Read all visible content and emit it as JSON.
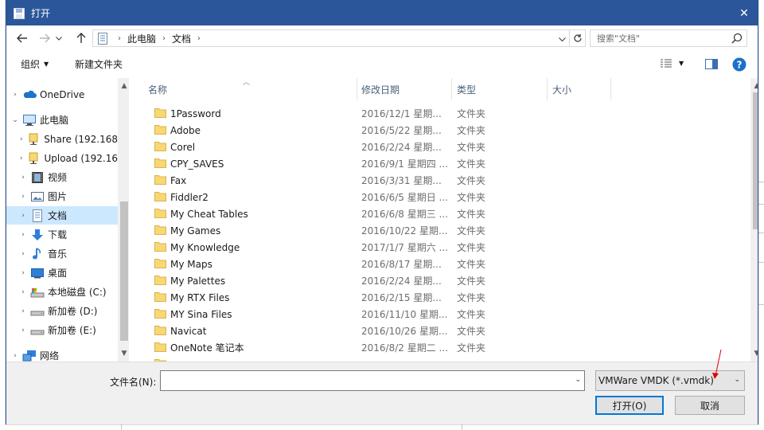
{
  "window": {
    "title": "打开",
    "close_glyph": "✕"
  },
  "address": {
    "crumbs": [
      "此电脑",
      "文档"
    ],
    "search_placeholder": "搜索\"文档\""
  },
  "toolbar": {
    "organize_label": "组织",
    "new_folder_label": "新建文件夹"
  },
  "nav": {
    "items": [
      {
        "label": "OneDrive",
        "icon": "onedrive-icon"
      },
      {
        "label": "此电脑",
        "icon": "computer-icon"
      },
      {
        "label": "Share (192.168",
        "icon": "network-drive-icon"
      },
      {
        "label": "Upload (192.16",
        "icon": "network-drive-icon"
      },
      {
        "label": "视频",
        "icon": "video-icon"
      },
      {
        "label": "图片",
        "icon": "pictures-icon"
      },
      {
        "label": "文档",
        "icon": "documents-icon"
      },
      {
        "label": "下载",
        "icon": "download-icon"
      },
      {
        "label": "音乐",
        "icon": "music-icon"
      },
      {
        "label": "桌面",
        "icon": "desktop-icon"
      },
      {
        "label": "本地磁盘 (C:)",
        "icon": "local-disk-icon"
      },
      {
        "label": "新加卷 (D:)",
        "icon": "drive-icon"
      },
      {
        "label": "新加卷 (E:)",
        "icon": "drive-icon"
      },
      {
        "label": "网络",
        "icon": "network-icon"
      }
    ]
  },
  "columns": {
    "name": "名称",
    "date": "修改日期",
    "type": "类型",
    "size": "大小"
  },
  "files": [
    {
      "name": "1Password",
      "date": "2016/12/1 星期...",
      "type": "文件夹"
    },
    {
      "name": "Adobe",
      "date": "2016/5/22 星期...",
      "type": "文件夹"
    },
    {
      "name": "Corel",
      "date": "2016/2/24 星期...",
      "type": "文件夹"
    },
    {
      "name": "CPY_SAVES",
      "date": "2016/9/1 星期四 ...",
      "type": "文件夹"
    },
    {
      "name": "Fax",
      "date": "2016/3/31 星期...",
      "type": "文件夹"
    },
    {
      "name": "Fiddler2",
      "date": "2016/6/5 星期日 ...",
      "type": "文件夹"
    },
    {
      "name": "My Cheat Tables",
      "date": "2016/6/8 星期三 ...",
      "type": "文件夹"
    },
    {
      "name": "My Games",
      "date": "2016/10/22 星期...",
      "type": "文件夹"
    },
    {
      "name": "My Knowledge",
      "date": "2017/1/7 星期六 ...",
      "type": "文件夹"
    },
    {
      "name": "My Maps",
      "date": "2016/8/17 星期...",
      "type": "文件夹"
    },
    {
      "name": "My Palettes",
      "date": "2016/2/24 星期...",
      "type": "文件夹"
    },
    {
      "name": "My RTX Files",
      "date": "2016/2/15 星期...",
      "type": "文件夹"
    },
    {
      "name": "MY Sina Files",
      "date": "2016/11/10 星期...",
      "type": "文件夹"
    },
    {
      "name": "Navicat",
      "date": "2016/10/26 星期...",
      "type": "文件夹"
    },
    {
      "name": "OneNote 笔记本",
      "date": "2016/8/2 星期二 ...",
      "type": "文件夹"
    }
  ],
  "bottom": {
    "filename_label": "文件名(N):",
    "filename_value": "",
    "filter_value": "VMWare VMDK (*.vmdk)",
    "open_label": "打开(O)",
    "cancel_label": "取消"
  },
  "colors": {
    "titlebar": "#2b579a",
    "selection": "#cce8ff",
    "folder": "#f8d775",
    "annotation_arrow": "#e00000"
  }
}
